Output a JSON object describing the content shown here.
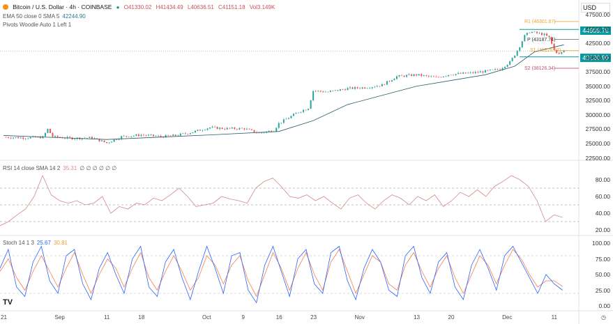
{
  "header": {
    "symbol": "Bitcoin / U.S. Dollar · 4h · COINBASE",
    "open": "O41330.02",
    "high": "H41434.49",
    "low": "L40636.51",
    "close": "C41151.18",
    "volume": "Vol3.149K",
    "ema_label": "EMA 50 close 0 SMA 5",
    "ema_value": "42244.90",
    "pivots_label": "Pivots Woodie Auto 1 Left 1",
    "currency": "USD"
  },
  "rsi_legend": {
    "label": "RSI 14 close SMA 14 2",
    "value": "35.31",
    "empty": "∅ ∅ ∅ ∅ ∅ ∅"
  },
  "stoch_legend": {
    "label": "Stoch 14 1 3",
    "k": "25.67",
    "d": "30.81"
  },
  "pivots": {
    "r1": "R1 (46301.87)",
    "p": "P (43187.74)",
    "s1": "S1 (41226.47)",
    "s2": "S2 (38126.34)"
  },
  "badges": {
    "high": "44909.76",
    "low": "40120.99"
  },
  "colors": {
    "up": "#26a69a",
    "down": "#ef5350",
    "ema": "#2a5d6a",
    "rsi": "#d08a88",
    "stoch_k": "#2962ff",
    "stoch_d": "#f57c4d",
    "badge": "#089aa0"
  },
  "chart_data": {
    "type": "line",
    "title": "Bitcoin / U.S. Dollar · 4h · COINBASE",
    "price_axis": {
      "ticks": [
        "47500.00",
        "45000.00",
        "42500.00",
        "40000.00",
        "37500.00",
        "35000.00",
        "32500.00",
        "30000.00",
        "27500.00",
        "25000.00",
        "22500.00"
      ],
      "range": [
        22500,
        47500
      ]
    },
    "rsi_axis": {
      "ticks": [
        "80.00",
        "60.00",
        "40.00",
        "20.00"
      ],
      "bands": [
        70,
        50,
        30
      ]
    },
    "stoch_axis": {
      "ticks": [
        "100.00",
        "75.00",
        "50.00",
        "25.00",
        "0.00"
      ]
    },
    "x_ticks": [
      {
        "label": "21",
        "day": 0
      },
      {
        "label": "Sep",
        "day": 11
      },
      {
        "label": "11",
        "day": 21
      },
      {
        "label": "18",
        "day": 28
      },
      {
        "label": "Oct",
        "day": 41
      },
      {
        "label": "9",
        "day": 49
      },
      {
        "label": "16",
        "day": 56
      },
      {
        "label": "23",
        "day": 63
      },
      {
        "label": "Nov",
        "day": 72
      },
      {
        "label": "13",
        "day": 84
      },
      {
        "label": "20",
        "day": 91
      },
      {
        "label": "Dec",
        "day": 102
      },
      {
        "label": "11",
        "day": 112
      }
    ],
    "price": {
      "days": [
        0,
        4,
        8,
        9,
        10,
        14,
        18,
        21,
        24,
        28,
        32,
        35,
        38,
        42,
        45,
        49,
        52,
        55,
        56,
        58,
        60,
        62,
        63,
        66,
        70,
        74,
        77,
        80,
        84,
        88,
        91,
        95,
        98,
        101,
        103,
        104,
        105,
        106,
        107,
        109,
        110,
        111,
        112,
        113,
        114
      ],
      "close": [
        26100,
        26000,
        26100,
        27500,
        26200,
        25900,
        26000,
        25100,
        26200,
        26500,
        26200,
        26400,
        26900,
        27800,
        27600,
        27600,
        26800,
        27300,
        28500,
        29500,
        30500,
        31200,
        34200,
        34000,
        34600,
        34800,
        35200,
        36700,
        37000,
        36500,
        37100,
        37300,
        37600,
        38000,
        39200,
        40500,
        42000,
        43800,
        44500,
        44200,
        44000,
        43500,
        41300,
        40600,
        41150
      ]
    },
    "ema50": {
      "days": [
        0,
        21,
        42,
        56,
        63,
        70,
        84,
        98,
        104,
        108,
        114
      ],
      "value": [
        26400,
        25700,
        26500,
        27100,
        29000,
        31800,
        35000,
        37000,
        38500,
        41000,
        42245
      ]
    },
    "rsi": [
      25,
      30,
      38,
      45,
      60,
      85,
      62,
      55,
      52,
      55,
      50,
      52,
      60,
      40,
      48,
      45,
      52,
      50,
      58,
      55,
      62,
      70,
      60,
      48,
      50,
      52,
      60,
      57,
      55,
      52,
      70,
      78,
      82,
      72,
      60,
      58,
      62,
      55,
      60,
      52,
      45,
      58,
      62,
      52,
      45,
      55,
      62,
      58,
      50,
      60,
      55,
      62,
      48,
      55,
      65,
      60,
      68,
      60,
      72,
      78,
      85,
      80,
      72,
      55,
      30,
      38,
      35
    ],
    "stoch_k": [
      60,
      90,
      30,
      15,
      70,
      95,
      40,
      20,
      80,
      90,
      35,
      10,
      60,
      85,
      50,
      20,
      75,
      95,
      30,
      15,
      70,
      90,
      45,
      10,
      55,
      95,
      60,
      20,
      80,
      85,
      25,
      5,
      65,
      95,
      55,
      15,
      75,
      90,
      35,
      20,
      85,
      95,
      40,
      10,
      60,
      90,
      70,
      25,
      15,
      80,
      95,
      45,
      20,
      70,
      85,
      30,
      10,
      65,
      90,
      60,
      25,
      80,
      95,
      70,
      45,
      20,
      50,
      35,
      25
    ],
    "stoch_d": [
      55,
      75,
      45,
      25,
      55,
      80,
      55,
      30,
      60,
      85,
      50,
      20,
      50,
      75,
      60,
      30,
      60,
      85,
      45,
      25,
      55,
      80,
      55,
      25,
      45,
      80,
      65,
      35,
      65,
      80,
      40,
      15,
      50,
      85,
      60,
      25,
      60,
      85,
      50,
      25,
      70,
      90,
      55,
      20,
      50,
      80,
      70,
      35,
      25,
      65,
      85,
      55,
      30,
      60,
      80,
      45,
      20,
      50,
      80,
      65,
      35,
      65,
      90,
      75,
      50,
      30,
      40,
      40,
      31
    ]
  }
}
